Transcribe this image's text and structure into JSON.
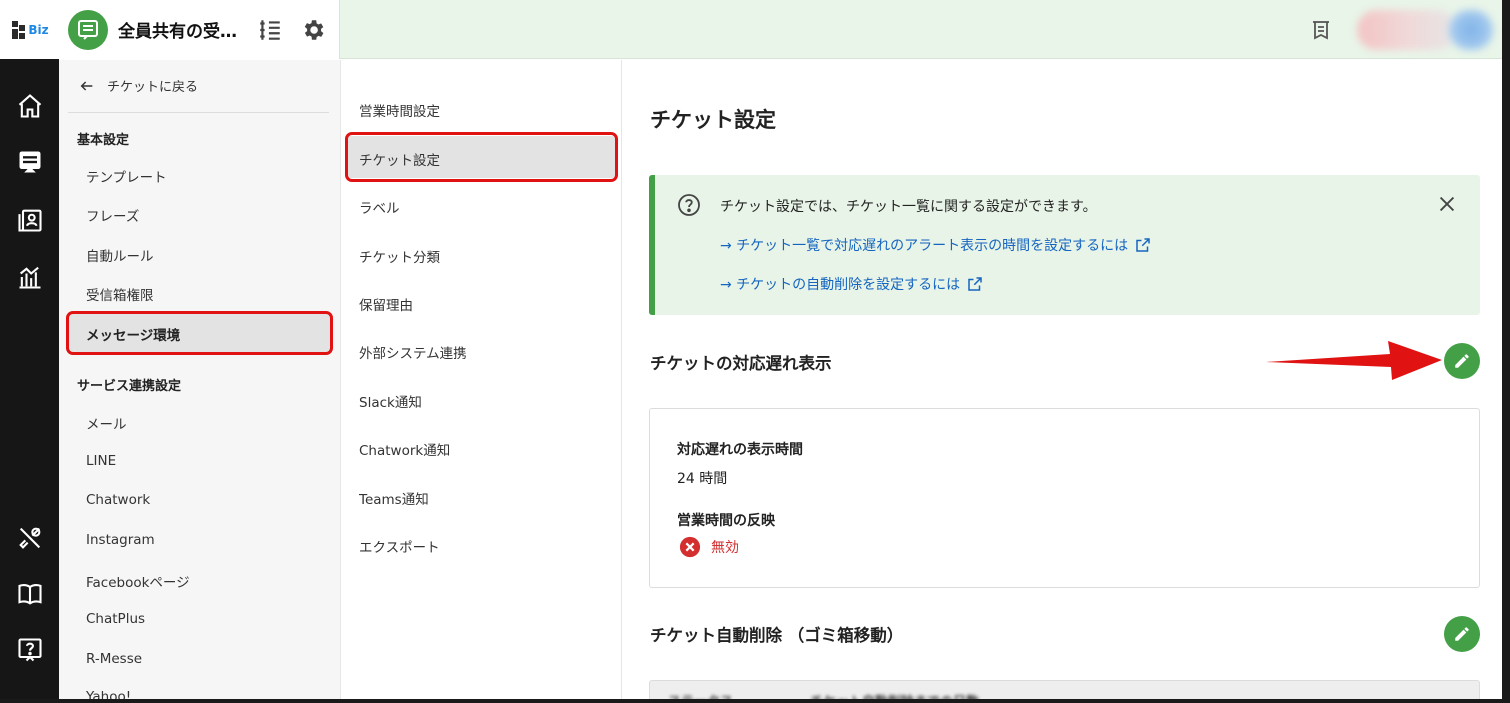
{
  "app": {
    "logo_text": "Biz"
  },
  "header": {
    "inbox_title": "全員共有の受…"
  },
  "nav": {
    "back_label": "チケットに戻る",
    "section_basic": "基本設定",
    "basic_items": [
      "テンプレート",
      "フレーズ",
      "自動ルール",
      "受信箱権限",
      "メッセージ環境"
    ],
    "section_service": "サービス連携設定",
    "service_items": [
      "メール",
      "LINE",
      "Chatwork",
      "Instagram",
      "Facebookページ",
      "ChatPlus",
      "R-Messe",
      "Yahoo!"
    ]
  },
  "subnav": {
    "items": [
      "営業時間設定",
      "チケット設定",
      "ラベル",
      "チケット分類",
      "保留理由",
      "外部システム連携",
      "Slack通知",
      "Chatwork通知",
      "Teams通知",
      "エクスポート"
    ]
  },
  "main": {
    "title": "チケット設定",
    "info": {
      "text": "チケット設定では、チケット一覧に関する設定ができます。",
      "link1": "→ チケット一覧で対応遅れのアラート表示の時間を設定するには",
      "link2": "→ チケットの自動削除を設定するには"
    },
    "section1": {
      "title": "チケットの対応遅れ表示",
      "field1_label": "対応遅れの表示時間",
      "field1_value": "24 時間",
      "field2_label": "営業時間の反映",
      "field2_value": "無効"
    },
    "section2": {
      "title": "チケット自動削除 （ゴミ箱移動）",
      "col1": "ステータス",
      "col2": "チケット自動削除までの日数"
    }
  },
  "colors": {
    "brand_green": "#43a047",
    "link_blue": "#1565c0",
    "highlight_red": "#e01212",
    "disabled_red": "#d32f2f"
  },
  "icons": {
    "rail": [
      "home-icon",
      "inbox-icon",
      "contacts-icon",
      "analytics-icon",
      "tools-icon",
      "book-icon",
      "help-icon"
    ],
    "header": [
      "message-icon",
      "list-icon",
      "gear-icon",
      "notification-icon"
    ]
  }
}
